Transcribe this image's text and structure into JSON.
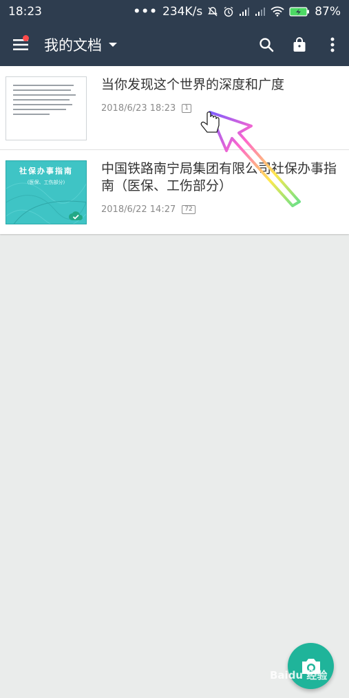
{
  "status_bar": {
    "time": "18:23",
    "dots": "•••",
    "net_speed": "234K/s",
    "battery": "87%"
  },
  "app_bar": {
    "title": "我的文档"
  },
  "documents": [
    {
      "title": "当你发现这个世界的深度和广度",
      "date": "2018/6/23 18:23",
      "pages": "1"
    },
    {
      "title": "中国铁路南宁局集团有限公司社保办事指南（医保、工伤部分）",
      "date": "2018/6/22 14:27",
      "pages": "72",
      "cover_title": "社保办事指南",
      "cover_subtitle": "(医保、工伤部分)"
    }
  ],
  "watermark": "Baidu 经验",
  "colors": {
    "app_bar": "#2e3d4f",
    "fab": "#1fb49a",
    "notification_dot": "#ff4b4b",
    "cover": "#3fc4c5"
  }
}
